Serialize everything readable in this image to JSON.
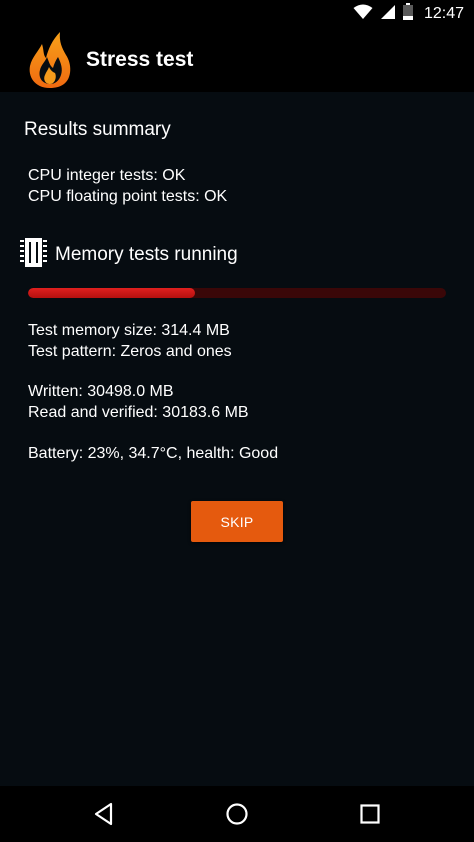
{
  "status_bar": {
    "time": "12:47",
    "icons": [
      "wifi-icon",
      "cell-signal-icon",
      "battery-icon"
    ]
  },
  "app_bar": {
    "title": "Stress test",
    "logo_icon": "flame-icon"
  },
  "results": {
    "title": "Results summary",
    "cpu_integer": "CPU integer tests: OK",
    "cpu_float": "CPU floating point tests: OK"
  },
  "memory": {
    "icon": "memory-chip-icon",
    "title": "Memory tests running",
    "progress": 0.4,
    "test_size": "Test memory size: 314.4 MB",
    "test_pattern": "Test pattern: Zeros and ones",
    "written": "Written: 30498.0 MB",
    "read_verified": "Read and verified: 30183.6 MB"
  },
  "battery": {
    "text": "Battery: 23%, 34.7°C,  health: Good"
  },
  "actions": {
    "skip_label": "SKIP"
  },
  "nav_bar": {
    "icons": [
      "back-icon",
      "home-icon",
      "recents-icon"
    ]
  },
  "colors": {
    "background": "#060c11",
    "bar_background": "#000000",
    "accent_orange": "#e55a0e",
    "progress_fill": "#d01818",
    "progress_track": "#3a0708",
    "text": "#ffffff"
  }
}
